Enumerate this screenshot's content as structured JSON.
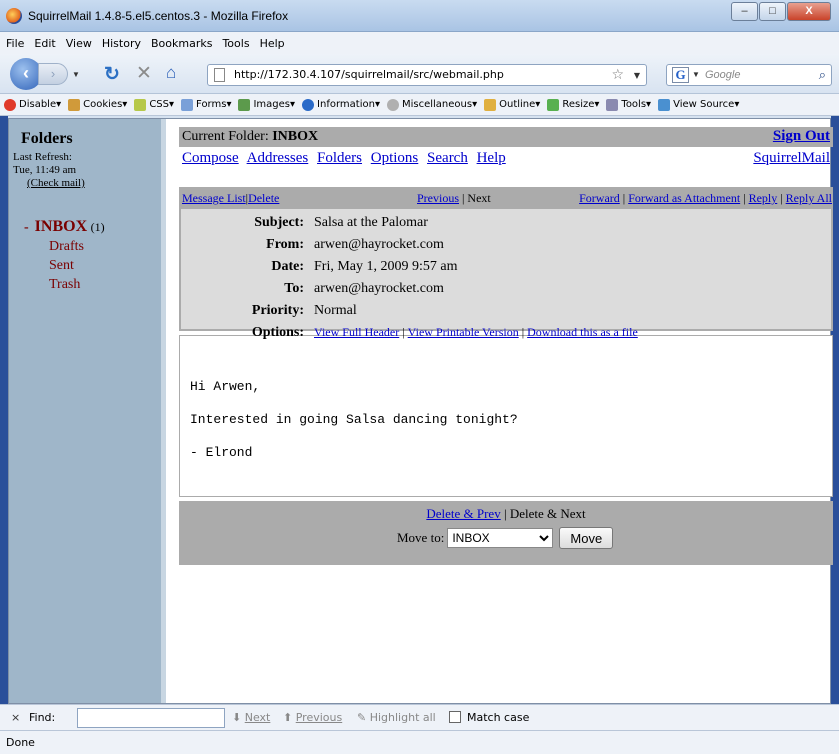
{
  "window": {
    "title": "SquirrelMail 1.4.8-5.el5.centos.3 - Mozilla Firefox",
    "min": "–",
    "max": "□",
    "close": "X"
  },
  "menu": [
    "File",
    "Edit",
    "View",
    "History",
    "Bookmarks",
    "Tools",
    "Help"
  ],
  "nav": {
    "url": "http://172.30.4.107/squirrelmail/src/webmail.php",
    "search_placeholder": "Google"
  },
  "devtoolbar": [
    "Disable",
    "Cookies",
    "CSS",
    "Forms",
    "Images",
    "Information",
    "Miscellaneous",
    "Outline",
    "Resize",
    "Tools",
    "View Source"
  ],
  "sidebar": {
    "heading": "Folders",
    "refresh_label": "Last Refresh:",
    "refresh_time": "Tue, 11:49 am",
    "check_mail": "(Check mail)",
    "inbox": "INBOX",
    "inbox_count": "(1)",
    "folders": [
      "Drafts",
      "Sent",
      "Trash"
    ]
  },
  "main": {
    "current_folder_label": "Current Folder:",
    "current_folder": "INBOX",
    "sign_out": "Sign Out",
    "nav_links": [
      "Compose",
      "Addresses",
      "Folders",
      "Options",
      "Search",
      "Help"
    ],
    "brand_link": "SquirrelMail",
    "msgbar": {
      "message_list": "Message List",
      "delete": "Delete",
      "previous": "Previous",
      "next": "Next",
      "forward": "Forward",
      "forward_attachment": "Forward as Attachment",
      "reply": "Reply",
      "reply_all": "Reply All"
    },
    "headers": {
      "subject_label": "Subject:",
      "subject": "Salsa at the Palomar",
      "from_label": "From:",
      "from": "arwen@hayrocket.com",
      "date_label": "Date:",
      "date": "Fri, May 1, 2009 9:57 am",
      "to_label": "To:",
      "to": "arwen@hayrocket.com",
      "priority_label": "Priority:",
      "priority": "Normal",
      "options_label": "Options:",
      "view_full_header": "View Full Header",
      "view_printable": "View Printable Version",
      "download": "Download this as a file"
    },
    "body_lines": [
      "Hi Arwen,",
      "Interested in going Salsa dancing tonight?",
      "- Elrond"
    ],
    "actions": {
      "delete_prev": "Delete & Prev",
      "delete_next": "Delete & Next",
      "move_to": "Move to:",
      "move_folder": "INBOX",
      "move_button": "Move"
    }
  },
  "findbar": {
    "close": "×",
    "label": "Find:",
    "next": "Next",
    "previous": "Previous",
    "highlight": "Highlight all",
    "match_case": "Match case"
  },
  "status": "Done"
}
